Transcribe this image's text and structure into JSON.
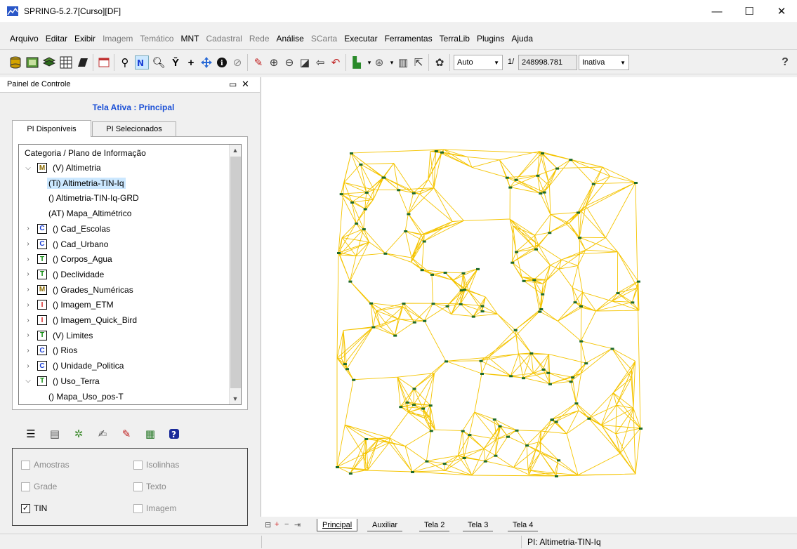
{
  "window": {
    "title": "SPRING-5.2.7[Curso][DF]",
    "minimize_glyph": "—",
    "maximize_glyph": "☐",
    "close_glyph": "✕"
  },
  "menu": [
    {
      "label": "Arquivo",
      "enabled": true
    },
    {
      "label": "Editar",
      "enabled": true
    },
    {
      "label": "Exibir",
      "enabled": true
    },
    {
      "label": "Imagem",
      "enabled": false
    },
    {
      "label": "Temático",
      "enabled": false
    },
    {
      "label": "MNT",
      "enabled": true
    },
    {
      "label": "Cadastral",
      "enabled": false
    },
    {
      "label": "Rede",
      "enabled": false
    },
    {
      "label": "Análise",
      "enabled": true
    },
    {
      "label": "SCarta",
      "enabled": false
    },
    {
      "label": "Executar",
      "enabled": true
    },
    {
      "label": "Ferramentas",
      "enabled": true
    },
    {
      "label": "TerraLib",
      "enabled": true
    },
    {
      "label": "Plugins",
      "enabled": true
    },
    {
      "label": "Ajuda",
      "enabled": true
    }
  ],
  "toolbar": {
    "scale_mode": "Auto",
    "scale_prefix": "1/",
    "scale_value": "248998.781",
    "state": "Inativa",
    "dropdown_glyph": "▼",
    "help_glyph": "?"
  },
  "panel": {
    "title": "Painel de Controle",
    "float_glyph": "🗗",
    "close_glyph": "✕",
    "active_screen": "Tela Ativa : Principal",
    "tabs": [
      "PI Disponíveis",
      "PI Selecionados"
    ],
    "tree_header": "Categoria / Plano de Informação",
    "tree": [
      {
        "chevron": "expanded",
        "badge": "M",
        "badge_color": "#8a6a00",
        "label": "(V) Altimetria",
        "level": 0
      },
      {
        "chevron": "",
        "badge": "",
        "label": "(Ti) Altimetria-TIN-Iq",
        "level": 1,
        "selected": true
      },
      {
        "chevron": "",
        "badge": "",
        "label": "() Altimetria-TIN-Iq-GRD",
        "level": 1
      },
      {
        "chevron": "",
        "badge": "",
        "label": "(AT) Mapa_Altimétrico",
        "level": 1
      },
      {
        "chevron": "collapsed",
        "badge": "C",
        "badge_color": "#1a3fd6",
        "label": "() Cad_Escolas",
        "level": 0
      },
      {
        "chevron": "collapsed",
        "badge": "C",
        "badge_color": "#1a3fd6",
        "label": "() Cad_Urbano",
        "level": 0
      },
      {
        "chevron": "collapsed",
        "badge": "T",
        "badge_color": "#0a8a0a",
        "label": "() Corpos_Agua",
        "level": 0
      },
      {
        "chevron": "collapsed",
        "badge": "T",
        "badge_color": "#0a8a0a",
        "label": "() Declividade",
        "level": 0
      },
      {
        "chevron": "collapsed",
        "badge": "M",
        "badge_color": "#8a6a00",
        "label": "() Grades_Numéricas",
        "level": 0
      },
      {
        "chevron": "collapsed",
        "badge": "I",
        "badge_color": "#d62020",
        "label": "() Imagem_ETM",
        "level": 0
      },
      {
        "chevron": "collapsed",
        "badge": "I",
        "badge_color": "#d62020",
        "label": "() Imagem_Quick_Bird",
        "level": 0
      },
      {
        "chevron": "collapsed",
        "badge": "T",
        "badge_color": "#0a8a0a",
        "label": "(V) Limites",
        "level": 0
      },
      {
        "chevron": "collapsed",
        "badge": "C",
        "badge_color": "#1a3fd6",
        "label": "() Rios",
        "level": 0
      },
      {
        "chevron": "collapsed",
        "badge": "C",
        "badge_color": "#1a3fd6",
        "label": "() Unidade_Politica",
        "level": 0
      },
      {
        "chevron": "expanded",
        "badge": "T",
        "badge_color": "#0a8a0a",
        "label": "() Uso_Terra",
        "level": 0
      },
      {
        "chevron": "",
        "badge": "",
        "label": "() Mapa_Uso_pos-T",
        "level": 1
      }
    ],
    "options": [
      {
        "label": "Amostras",
        "checked": false,
        "enabled": false
      },
      {
        "label": "Isolinhas",
        "checked": false,
        "enabled": false
      },
      {
        "label": "Grade",
        "checked": false,
        "enabled": false
      },
      {
        "label": "Texto",
        "checked": false,
        "enabled": false
      },
      {
        "label": "TIN",
        "checked": true,
        "enabled": true
      },
      {
        "label": "Imagem",
        "checked": false,
        "enabled": false
      }
    ]
  },
  "canvas": {
    "tin_color": "#f5c400",
    "node_color": "#1e6b2a"
  },
  "screen_tabs": {
    "controls": [
      "⊟",
      "+",
      "−",
      "⇥"
    ],
    "tabs": [
      "Principal",
      "Auxiliar",
      "Tela 2",
      "Tela 3",
      "Tela 4"
    ],
    "active": "Principal"
  },
  "status": {
    "pi": "PI: Altimetria-TIN-Iq"
  }
}
